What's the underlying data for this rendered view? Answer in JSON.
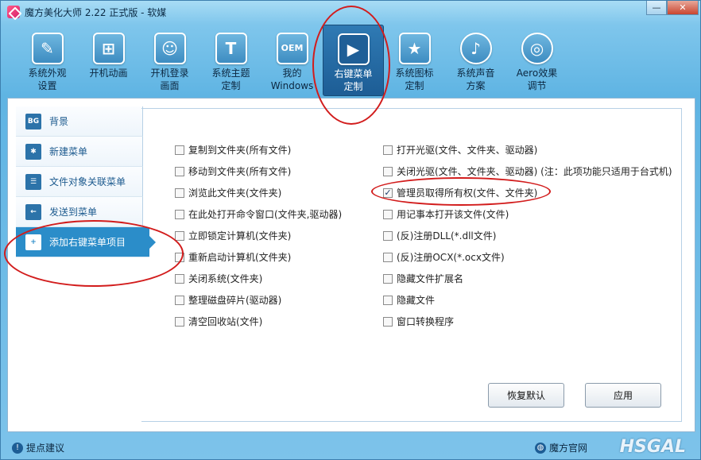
{
  "window": {
    "title": "魔方美化大师 2.22 正式版 - 软媒",
    "min": "—",
    "close": "✕"
  },
  "toolbar": [
    {
      "label": "系统外观\n设置",
      "icon": "✎"
    },
    {
      "label": "开机动画",
      "icon": "⊞"
    },
    {
      "label": "开机登录\n画面",
      "icon": "☺"
    },
    {
      "label": "系统主题\n定制",
      "icon": "T"
    },
    {
      "label": "我的\nWindows",
      "icon": "OEM"
    },
    {
      "label": "右键菜单\n定制",
      "icon": "▶"
    },
    {
      "label": "系统图标\n定制",
      "icon": "★"
    },
    {
      "label": "系统声音\n方案",
      "icon": "♪"
    },
    {
      "label": "Aero效果\n调节",
      "icon": "◎"
    }
  ],
  "sidebar": [
    {
      "label": "背景",
      "icon": "BG"
    },
    {
      "label": "新建菜单",
      "icon": "✱"
    },
    {
      "label": "文件对象关联菜单",
      "icon": "☰"
    },
    {
      "label": "发送到菜单",
      "icon": "←"
    },
    {
      "label": "添加右键菜单项目",
      "icon": "+"
    }
  ],
  "options_left": [
    {
      "label": "复制到文件夹(所有文件)",
      "checked": false
    },
    {
      "label": "移动到文件夹(所有文件)",
      "checked": false
    },
    {
      "label": "浏览此文件夹(文件夹)",
      "checked": false
    },
    {
      "label": "在此处打开命令窗口(文件夹,驱动器)",
      "checked": false
    },
    {
      "label": "立即锁定计算机(文件夹)",
      "checked": false
    },
    {
      "label": "重新启动计算机(文件夹)",
      "checked": false
    },
    {
      "label": "关闭系统(文件夹)",
      "checked": false
    },
    {
      "label": "整理磁盘碎片(驱动器)",
      "checked": false
    },
    {
      "label": "清空回收站(文件)",
      "checked": false
    }
  ],
  "options_right": [
    {
      "label": "打开光驱(文件、文件夹、驱动器)",
      "checked": false
    },
    {
      "label": "关闭光驱(文件、文件夹、驱动器)  (注：此项功能只适用于台式机)",
      "checked": false
    },
    {
      "label": "管理员取得所有权(文件、文件夹)",
      "checked": true
    },
    {
      "label": "用记事本打开该文件(文件)",
      "checked": false
    },
    {
      "label": "(反)注册DLL(*.dll文件)",
      "checked": false
    },
    {
      "label": "(反)注册OCX(*.ocx文件)",
      "checked": false
    },
    {
      "label": "隐藏文件扩展名",
      "checked": false
    },
    {
      "label": "隐藏文件",
      "checked": false
    },
    {
      "label": "窗口转换程序",
      "checked": false
    }
  ],
  "buttons": {
    "restore": "恢复默认",
    "apply": "应用"
  },
  "status": {
    "suggest": "提点建议",
    "site": "魔方官网",
    "watermark": "HSGAL"
  }
}
